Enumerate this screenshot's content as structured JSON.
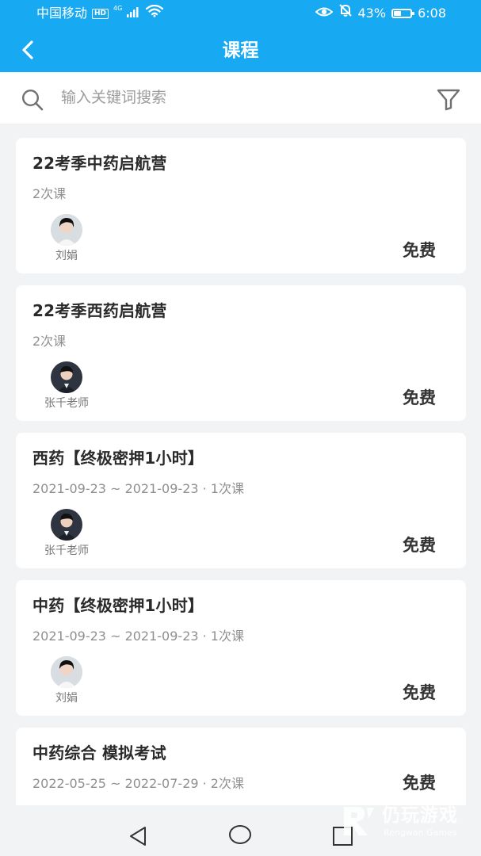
{
  "status_bar": {
    "carrier": "中国移动",
    "hd_label": "HD",
    "network": "4G",
    "battery": "43%",
    "battery_level": 0.43,
    "time": "6:08"
  },
  "header": {
    "title": "课程"
  },
  "search": {
    "placeholder": "输入关键词搜索",
    "value": ""
  },
  "courses": [
    {
      "title": "22考季中药启航营",
      "meta": "2次课",
      "teacher": "刘娟",
      "price": "免费"
    },
    {
      "title": "22考季西药启航营",
      "meta": "2次课",
      "teacher": "张千老师",
      "price": "免费"
    },
    {
      "title": "西药【终极密押1小时】",
      "meta": "2021-09-23 ~ 2021-09-23 · 1次课",
      "teacher": "张千老师",
      "price": "免费"
    },
    {
      "title": "中药【终极密押1小时】",
      "meta": "2021-09-23 ~ 2021-09-23 · 1次课",
      "teacher": "刘娟",
      "price": "免费"
    },
    {
      "title": "中药综合 模拟考试",
      "meta": "2022-05-25 ~ 2022-07-29 · 2次课",
      "teacher": "",
      "price": "免费"
    }
  ],
  "watermark": {
    "main": "仍玩游戏",
    "sub": "Rengwan Games"
  },
  "colors": {
    "brand_blue": "#17a9f1",
    "background": "#f2f3f5",
    "card": "#ffffff",
    "text_primary": "#2a2a2a",
    "text_secondary": "#8f8f8f"
  },
  "icons": {
    "back": "chevron-left-icon",
    "search": "search-icon",
    "filter": "funnel-icon",
    "eye": "eye-icon",
    "mute": "bell-off-icon",
    "wifi": "wifi-icon",
    "signal": "signal-icon",
    "system_back": "triangle-back-icon",
    "system_home": "circle-home-icon",
    "system_recent": "square-recent-icon"
  }
}
